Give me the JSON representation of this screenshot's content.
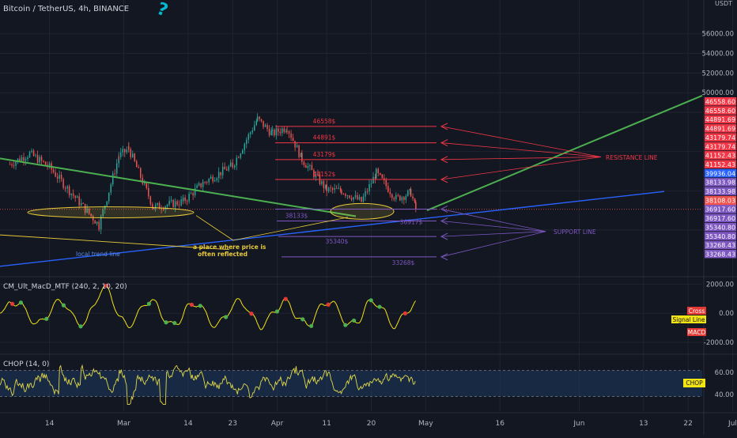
{
  "symbol": "Bitcoin / TetherUS, 4h, BINANCE",
  "currency": "USDT",
  "colors": {
    "background": "#131722",
    "grid": "#1f2430",
    "candle_up": "#26a69a",
    "candle_down": "#ef5350",
    "resistance": "#f23645",
    "support": "#7e57c2",
    "trend_green": "#4caf50",
    "trend_blue": "#2962ff",
    "trend_yellow": "#e7c93a",
    "price_line": "#ef5350",
    "macd_green": "#4caf50",
    "macd_red": "#e53935",
    "macd_signal": "#f2e313",
    "chop_line": "#e1d84a",
    "chop_band": "#1e3a5f"
  },
  "chart_data": [
    {
      "type": "candlestick",
      "pane": "price",
      "y_axis_ticks": [
        56000,
        54000,
        52000,
        50000
      ],
      "ylim": [
        31400,
        58800
      ],
      "x_tick_labels": [
        "14",
        "Mar",
        "14",
        "23",
        "Apr",
        "11",
        "20",
        "May",
        "16",
        "Jun",
        "13",
        "22",
        "Jul"
      ],
      "ohlc_anchor_path": [
        {
          "date": "2022-02-06",
          "close": 42700
        },
        {
          "date": "2022-02-10",
          "close": 43800
        },
        {
          "date": "2022-02-14",
          "close": 42400
        },
        {
          "date": "2022-02-18",
          "close": 40000
        },
        {
          "date": "2022-02-24",
          "close": 36500
        },
        {
          "date": "2022-02-28",
          "close": 43500
        },
        {
          "date": "2022-03-02",
          "close": 44300
        },
        {
          "date": "2022-03-07",
          "close": 38300
        },
        {
          "date": "2022-03-13",
          "close": 38900
        },
        {
          "date": "2022-03-17",
          "close": 40800
        },
        {
          "date": "2022-03-23",
          "close": 42600
        },
        {
          "date": "2022-03-28",
          "close": 47300
        },
        {
          "date": "2022-03-31",
          "close": 45800
        },
        {
          "date": "2022-04-03",
          "close": 46500
        },
        {
          "date": "2022-04-06",
          "close": 43200
        },
        {
          "date": "2022-04-11",
          "close": 40100
        },
        {
          "date": "2022-04-14",
          "close": 40000
        },
        {
          "date": "2022-04-18",
          "close": 38900
        },
        {
          "date": "2022-04-21",
          "close": 41800
        },
        {
          "date": "2022-04-25",
          "close": 39200
        },
        {
          "date": "2022-04-28",
          "close": 39800
        },
        {
          "date": "2022-04-29",
          "close": 38108
        }
      ],
      "current_price": 38108.03,
      "countdown": "03:52:21",
      "price_labels": [
        {
          "text": "46558.60",
          "kind": "resistance"
        },
        {
          "text": "46558.60",
          "kind": "resistance"
        },
        {
          "text": "44891.69",
          "kind": "resistance"
        },
        {
          "text": "44891.69",
          "kind": "resistance"
        },
        {
          "text": "43179.74",
          "kind": "resistance"
        },
        {
          "text": "43179.74",
          "kind": "resistance"
        },
        {
          "text": "41152.43",
          "kind": "resistance"
        },
        {
          "text": "41152.43",
          "kind": "resistance"
        },
        {
          "text": "39936.04",
          "kind": "blue"
        },
        {
          "text": "38133.98",
          "kind": "support"
        },
        {
          "text": "38133.98",
          "kind": "support"
        },
        {
          "text": "38108.03",
          "kind": "current"
        },
        {
          "text": "36917.60",
          "kind": "support"
        },
        {
          "text": "36917.60",
          "kind": "support"
        },
        {
          "text": "35340.80",
          "kind": "support"
        },
        {
          "text": "35340.80",
          "kind": "support"
        },
        {
          "text": "33268.43",
          "kind": "support"
        },
        {
          "text": "33268.43",
          "kind": "support"
        }
      ],
      "resistance_levels": [
        {
          "price": 46558.6,
          "label": "46558$"
        },
        {
          "price": 44891.69,
          "label": "44891$"
        },
        {
          "price": 43179.74,
          "label": "43179$"
        },
        {
          "price": 41152.43,
          "label": "41152$"
        }
      ],
      "support_levels": [
        {
          "price": 38133.98,
          "label": "38133$"
        },
        {
          "price": 36917.6,
          "label": "36917$"
        },
        {
          "price": 35340.8,
          "label": "35340$"
        },
        {
          "price": 33268.43,
          "label": "33268$"
        }
      ],
      "annotations": {
        "resistance_line": "RESISTANCE LINE",
        "support_line": "SUPPORT LINE",
        "local_trend_line": "local trend line",
        "price_reflected_1": "a place where price is",
        "price_reflected_2": "often reflected"
      }
    },
    {
      "type": "line",
      "pane": "macd",
      "indicator": "CM_Ult_MacD_MTF (240, 2, 10, 20)",
      "y_axis_ticks": [
        2000,
        0,
        -2000
      ],
      "y_axis_labels": [
        "2000.00",
        "0.00",
        "-2000.00"
      ],
      "ylim": [
        -2700,
        2400
      ],
      "legend": [
        {
          "name": "Cross",
          "color": "#e53935"
        },
        {
          "name": "Signal Line",
          "color": "#f2e313"
        },
        {
          "name": "MACD",
          "color": "#e53935"
        }
      ]
    },
    {
      "type": "line",
      "pane": "chop",
      "indicator": "CHOP (14, 0)",
      "y_axis_ticks": [
        60,
        40
      ],
      "y_axis_labels": [
        "60.00",
        "40.00"
      ],
      "band": [
        38.2,
        61.8
      ],
      "legend_label": "CHOP"
    }
  ]
}
